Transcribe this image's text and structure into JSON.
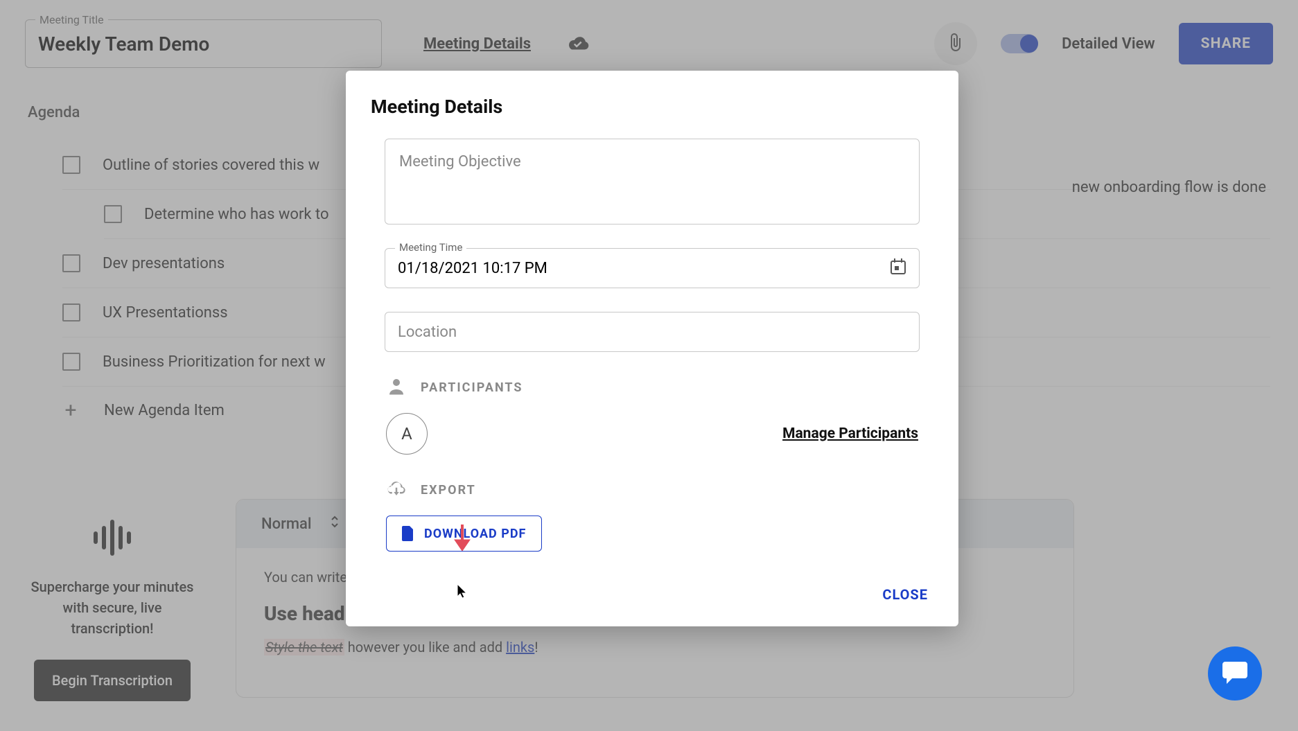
{
  "header": {
    "title_label": "Meeting Title",
    "title_value": "Weekly Team Demo",
    "details_link": "Meeting Details",
    "detailed_view_label": "Detailed View",
    "share_label": "SHARE"
  },
  "agenda": {
    "heading": "Agenda",
    "items": [
      {
        "text": "Outline of stories covered this w"
      },
      {
        "text": "Determine who has work to",
        "sub": true
      },
      {
        "text": "Dev presentations"
      },
      {
        "text": "UX Presentationss"
      },
      {
        "text": "Business Prioritization for next w"
      }
    ],
    "right_extra": "new onboarding flow is done",
    "new_item_label": "New Agenda Item"
  },
  "editor": {
    "style_selector": "Normal",
    "line1_prefix": "You can write",
    "heading": "Use head",
    "styled_text": "Style the text",
    "mid_text": " however you like and add ",
    "link_text": "links",
    "trailing": "!"
  },
  "transcribe": {
    "pitch": "Supercharge your minutes with secure, live transcription!",
    "button": "Begin Transcription"
  },
  "modal": {
    "title": "Meeting Details",
    "objective_placeholder": "Meeting Objective",
    "time_label": "Meeting Time",
    "time_value": "01/18/2021 10:17 PM",
    "location_placeholder": "Location",
    "participants_label": "PARTICIPANTS",
    "participant_initial": "A",
    "manage_label": "Manage Participants",
    "export_label": "EXPORT",
    "download_label": "DOWNLOAD PDF",
    "close_label": "CLOSE"
  }
}
